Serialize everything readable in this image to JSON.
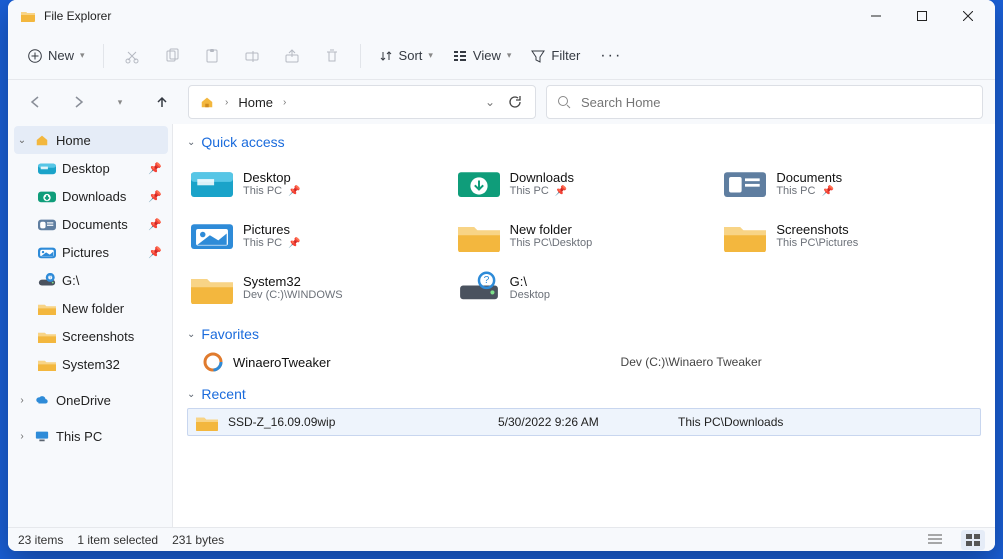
{
  "title": "File Explorer",
  "toolbar": {
    "new": "New",
    "sort": "Sort",
    "view": "View",
    "filter": "Filter"
  },
  "breadcrumb": {
    "root": "Home"
  },
  "search": {
    "placeholder": "Search Home"
  },
  "sidebar": {
    "home": "Home",
    "items": [
      {
        "label": "Desktop",
        "pinned": true,
        "icon": "desktop"
      },
      {
        "label": "Downloads",
        "pinned": true,
        "icon": "downloads"
      },
      {
        "label": "Documents",
        "pinned": true,
        "icon": "documents"
      },
      {
        "label": "Pictures",
        "pinned": true,
        "icon": "pictures"
      },
      {
        "label": "G:\\",
        "pinned": false,
        "icon": "drive"
      },
      {
        "label": "New folder",
        "pinned": false,
        "icon": "folder"
      },
      {
        "label": "Screenshots",
        "pinned": false,
        "icon": "folder"
      },
      {
        "label": "System32",
        "pinned": false,
        "icon": "folder"
      }
    ],
    "onedrive": "OneDrive",
    "thispc": "This PC"
  },
  "sections": {
    "quick": "Quick access",
    "fav": "Favorites",
    "recent": "Recent"
  },
  "quick": [
    {
      "name": "Desktop",
      "sub": "This PC",
      "pin": true,
      "icon": "desktop",
      "tint": "#1aa3c9"
    },
    {
      "name": "Downloads",
      "sub": "This PC",
      "pin": true,
      "icon": "downloads",
      "tint": "#0f9d7a"
    },
    {
      "name": "Documents",
      "sub": "This PC",
      "pin": true,
      "icon": "documents",
      "tint": "#5f7ea0"
    },
    {
      "name": "Pictures",
      "sub": "This PC",
      "pin": true,
      "icon": "pictures",
      "tint": "#2e8bd8"
    },
    {
      "name": "New folder",
      "sub": "This PC\\Desktop",
      "pin": false,
      "icon": "folder",
      "tint": "#f3b73e"
    },
    {
      "name": "Screenshots",
      "sub": "This PC\\Pictures",
      "pin": false,
      "icon": "folder",
      "tint": "#f3b73e"
    },
    {
      "name": "System32",
      "sub": "Dev (C:)\\WINDOWS",
      "pin": false,
      "icon": "folder",
      "tint": "#f3b73e"
    },
    {
      "name": "G:\\",
      "sub": "Desktop",
      "pin": false,
      "icon": "drive",
      "tint": "#5b6470"
    }
  ],
  "favorites": [
    {
      "name": "WinaeroTweaker",
      "loc": "Dev (C:)\\Winaero Tweaker"
    }
  ],
  "recent": [
    {
      "name": "SSD-Z_16.09.09wip",
      "date": "5/30/2022 9:26 AM",
      "loc": "This PC\\Downloads"
    }
  ],
  "status": {
    "count": "23 items",
    "selected": "1 item selected",
    "size": "231 bytes"
  }
}
